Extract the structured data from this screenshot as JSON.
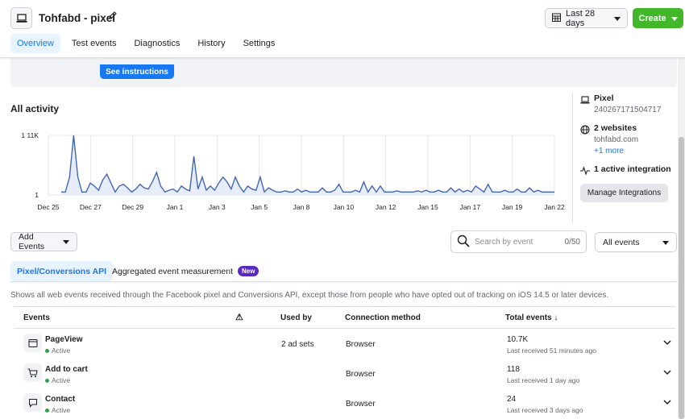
{
  "header": {
    "title": "Tohfabd - pixel",
    "date_range": "Last 28 days",
    "create_label": "Create",
    "tabs": [
      "Overview",
      "Test events",
      "Diagnostics",
      "History",
      "Settings"
    ]
  },
  "banner": {
    "button_label": "See instructions"
  },
  "activity": {
    "title": "All activity"
  },
  "chart_data": {
    "type": "line",
    "title": "All activity",
    "ytick_labels": [
      "1 11K",
      "1"
    ],
    "x_tick_labels": [
      "Dec 25",
      "Dec 27",
      "Dec 29",
      "Jan 1",
      "Jan 3",
      "Jan 5",
      "Jan 8",
      "Jan 10",
      "Jan 12",
      "Jan 15",
      "Jan 17",
      "Jan 19",
      "Jan 22"
    ],
    "series": [
      {
        "color": "#4267b2",
        "values": [
          0.05,
          0.05,
          0.3,
          1.0,
          0.3,
          0.05,
          0.05,
          0.2,
          0.15,
          0.08,
          0.25,
          0.35,
          0.2,
          0.05,
          0.15,
          0.18,
          0.12,
          0.05,
          0.1,
          0.18,
          0.12,
          0.1,
          0.22,
          0.38,
          0.15,
          0.05,
          0.08,
          0.1,
          0.05,
          0.15,
          0.1,
          0.07,
          0.65,
          0.1,
          0.3,
          0.08,
          0.15,
          0.08,
          0.2,
          0.3,
          0.22,
          0.1,
          0.3,
          0.15,
          0.05,
          0.15,
          0.1,
          0.08,
          0.3,
          0.05,
          0.12,
          0.08,
          0.05,
          0.05,
          0.07,
          0.05,
          0.05,
          0.1,
          0.05,
          0.08,
          0.05,
          0.05,
          0.05,
          0.12,
          0.05,
          0.05,
          0.08,
          0.18,
          0.05,
          0.05,
          0.05,
          0.08,
          0.05,
          0.22,
          0.05,
          0.15,
          0.05,
          0.15,
          0.05,
          0.05,
          0.05,
          0.07,
          0.05,
          0.05,
          0.05,
          0.05,
          0.07,
          0.05,
          0.08,
          0.05,
          0.05,
          0.08,
          0.05,
          0.05,
          0.12,
          0.05,
          0.1,
          0.05,
          0.08,
          0.05,
          0.15,
          0.1,
          0.05,
          0.18,
          0.05,
          0.05,
          0.05,
          0.08,
          0.05,
          0.05,
          0.1,
          0.05,
          0.05,
          0.12,
          0.05,
          0.08,
          0.05,
          0.05,
          0.05,
          0.05
        ]
      }
    ],
    "grid": true
  },
  "side": {
    "pixel_label": "Pixel",
    "pixel_id": "240267171504717",
    "websites_label": "2 websites",
    "website": "tohfabd.com",
    "more_link": "+1 more",
    "integration_label": "1 active integration",
    "manage_button": "Manage Integrations"
  },
  "controls": {
    "add_events": "Add Events",
    "search_placeholder": "Search by event",
    "search_count": "0/50",
    "filter_value": "All events"
  },
  "subtabs": {
    "first": "Pixel/Conversions API",
    "second": "Aggregated event measurement",
    "badge": "New"
  },
  "description": "Shows all web events received through the Facebook pixel and Conversions API, except those from people who have opted out of tracking on iOS 14.5 or later devices.",
  "table": {
    "headers": {
      "events": "Events",
      "warning": "⚠",
      "used_by": "Used by",
      "connection": "Connection method",
      "total": "Total events ↓"
    },
    "rows": [
      {
        "name": "PageView",
        "status": "Active",
        "used_by": "2 ad sets",
        "connection": "Browser",
        "total": "10.7K",
        "last": "Last received 51 minutes ago",
        "icon": "page-icon"
      },
      {
        "name": "Add to cart",
        "status": "Active",
        "used_by": "",
        "connection": "Browser",
        "total": "118",
        "last": "Last received 1 day ago",
        "icon": "cart-icon"
      },
      {
        "name": "Contact",
        "status": "Active",
        "used_by": "",
        "connection": "Browser",
        "total": "24",
        "last": "Last received 3 days ago",
        "icon": "chat-icon"
      }
    ]
  },
  "colors": {
    "accent": "#1877f2",
    "create": "#42b72a",
    "badge": "#5b2ac4",
    "active_dot": "#31a24c"
  }
}
